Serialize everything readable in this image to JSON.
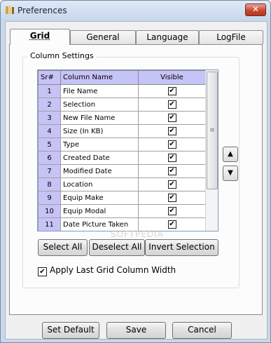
{
  "window": {
    "title": "Preferences",
    "close_glyph": "✕"
  },
  "tabs": [
    {
      "label": "Grid"
    },
    {
      "label": "General"
    },
    {
      "label": "Language"
    },
    {
      "label": "LogFile"
    }
  ],
  "group": {
    "label": "Column Settings"
  },
  "table": {
    "headers": [
      "Sr#",
      "Column Name",
      "Visible"
    ],
    "rows": [
      {
        "num": "1",
        "name": "File Name",
        "visible": true
      },
      {
        "num": "2",
        "name": "Selection",
        "visible": true
      },
      {
        "num": "3",
        "name": "New File Name",
        "visible": true
      },
      {
        "num": "4",
        "name": "Size (In KB)",
        "visible": true
      },
      {
        "num": "5",
        "name": "Type",
        "visible": true
      },
      {
        "num": "6",
        "name": "Created Date",
        "visible": true
      },
      {
        "num": "7",
        "name": "Modified Date",
        "visible": true
      },
      {
        "num": "8",
        "name": "Location",
        "visible": true
      },
      {
        "num": "9",
        "name": "Equip Make",
        "visible": true
      },
      {
        "num": "10",
        "name": "Equip Modal",
        "visible": true
      },
      {
        "num": "11",
        "name": "Date Picture Taken",
        "visible": true
      }
    ]
  },
  "buttons": {
    "select_all": "Select All",
    "deselect_all": "Deselect All",
    "invert_selection": "Invert Selection",
    "set_default": "Set Default",
    "save": "Save",
    "cancel": "Cancel"
  },
  "apply_width": {
    "label": "Apply Last Grid Column Width",
    "checked": true
  },
  "watermark": "SOFTPEDIA",
  "icons": {
    "move_up": "triangle-up",
    "move_down": "triangle-down",
    "check": "✔"
  }
}
